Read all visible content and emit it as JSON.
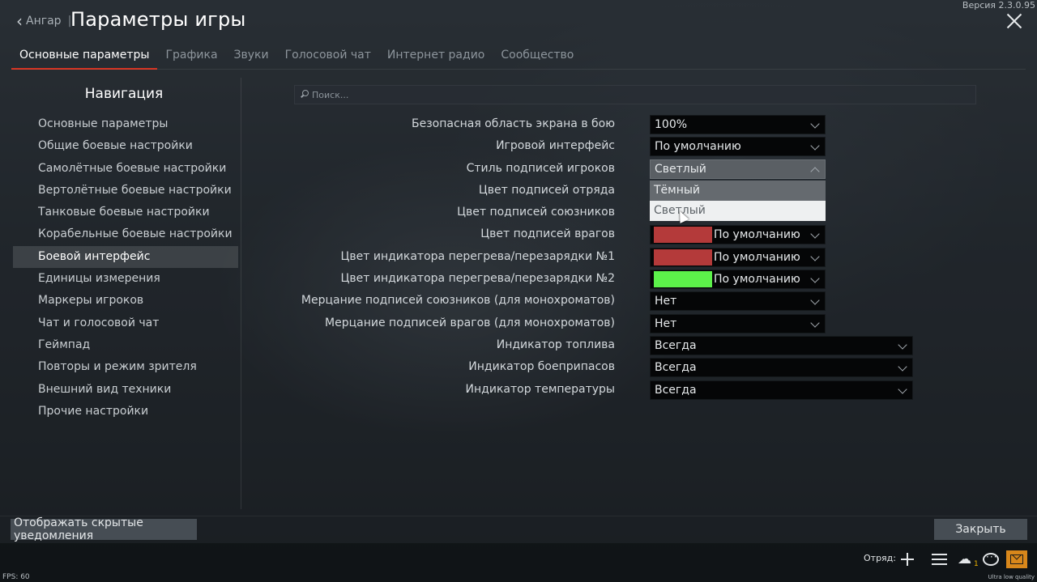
{
  "header": {
    "back_label": "Ангар",
    "back_separator": "|",
    "title": "Параметры игры",
    "version": "Версия 2.3.0.95"
  },
  "tabs": [
    {
      "label": "Основные параметры",
      "active": true
    },
    {
      "label": "Графика"
    },
    {
      "label": "Звуки"
    },
    {
      "label": "Голосовой чат"
    },
    {
      "label": "Интернет радио"
    },
    {
      "label": "Сообщество"
    }
  ],
  "sidebar": {
    "title": "Навигация",
    "items": [
      {
        "label": "Основные параметры"
      },
      {
        "label": "Общие боевые настройки"
      },
      {
        "label": "Самолётные боевые настройки"
      },
      {
        "label": "Вертолётные боевые настройки"
      },
      {
        "label": "Танковые боевые настройки"
      },
      {
        "label": "Корабельные боевые настройки"
      },
      {
        "label": "Боевой интерфейс",
        "active": true
      },
      {
        "label": "Единицы измерения"
      },
      {
        "label": "Маркеры игроков"
      },
      {
        "label": "Чат и голосовой чат"
      },
      {
        "label": "Геймпад"
      },
      {
        "label": "Повторы и режим зрителя"
      },
      {
        "label": "Внешний вид техники"
      },
      {
        "label": "Прочие настройки"
      }
    ]
  },
  "search": {
    "placeholder": "Поиск..."
  },
  "settings": [
    {
      "label": "Безопасная область экрана в бою",
      "value": "100%"
    },
    {
      "label": "Игровой интерфейс",
      "value": "По умолчанию"
    },
    {
      "label": "Стиль подписей игроков",
      "value": "Светлый",
      "open": true
    },
    {
      "label": "Цвет подписей отряда",
      "value": ""
    },
    {
      "label": "Цвет подписей союзников",
      "value": ""
    },
    {
      "label": "Цвет подписей врагов",
      "value": "По умолчанию",
      "swatch": "#b43a3a"
    },
    {
      "label": "Цвет индикатора перегрева/перезарядки №1",
      "value": "По умолчанию",
      "swatch": "#b43a3a"
    },
    {
      "label": "Цвет индикатора перегрева/перезарядки №2",
      "value": "По умолчанию",
      "swatch": "#5cf24a"
    },
    {
      "label": "Мерцание подписей союзников (для монохроматов)",
      "value": "Нет"
    },
    {
      "label": "Мерцание подписей врагов (для монохроматов)",
      "value": "Нет"
    },
    {
      "label": "Индикатор топлива",
      "value": "Всегда",
      "wide": true
    },
    {
      "label": "Индикатор боеприпасов",
      "value": "Всегда",
      "wide": true
    },
    {
      "label": "Индикатор температуры",
      "value": "Всегда",
      "wide": true
    }
  ],
  "dropdown_options": [
    "Тёмный",
    "Светлый"
  ],
  "buttons": {
    "show_notifications": "Отображать скрытые уведомления",
    "close": "Закрыть"
  },
  "statusbar": {
    "squad_label": "Отряд:",
    "friends_count": "1",
    "fps": "FPS: 60",
    "quality": "Ultra low quality"
  },
  "colors": {
    "accent": "#d6311f",
    "mail": "#d8871b"
  },
  "icons": [
    "chevron-left-icon",
    "close-icon",
    "search-icon",
    "chevron-down-icon",
    "plus-icon",
    "list-icon",
    "friends-icon",
    "chat-icon",
    "mail-icon"
  ]
}
